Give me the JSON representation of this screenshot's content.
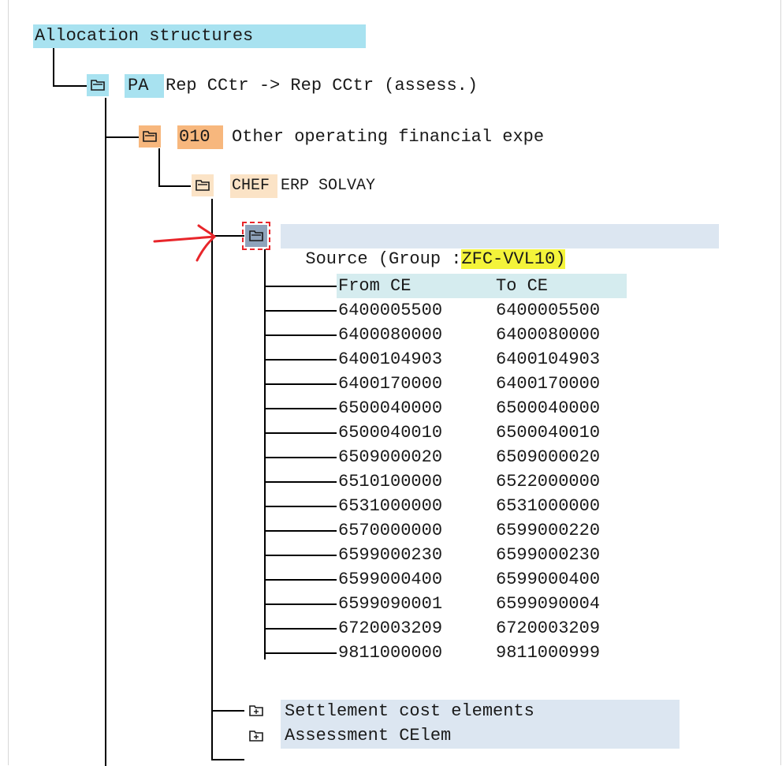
{
  "tree": {
    "root_label": "Allocation structures",
    "level1": {
      "code": "PA",
      "text": "Rep CCtr -> Rep CCtr (assess.)"
    },
    "level2": {
      "code": "010",
      "text": "Other operating financial expe"
    },
    "level3": {
      "code": "CHEF",
      "text": "ERP SOLVAY"
    },
    "source": {
      "prefix": "Source (Group :",
      "group": "ZFC-VVL10",
      "suffix": ")"
    },
    "ce_table": {
      "headers": [
        "From CE",
        "To CE"
      ],
      "rows": [
        [
          "6400005500",
          "6400005500"
        ],
        [
          "6400080000",
          "6400080000"
        ],
        [
          "6400104903",
          "6400104903"
        ],
        [
          "6400170000",
          "6400170000"
        ],
        [
          "6500040000",
          "6500040000"
        ],
        [
          "6500040010",
          "6500040010"
        ],
        [
          "6509000020",
          "6509000020"
        ],
        [
          "6510100000",
          "6522000000"
        ],
        [
          "6531000000",
          "6531000000"
        ],
        [
          "6570000000",
          "6599000220"
        ],
        [
          "6599000230",
          "6599000230"
        ],
        [
          "6599000400",
          "6599000400"
        ],
        [
          "6599090001",
          "6599090004"
        ],
        [
          "6720003209",
          "6720003209"
        ],
        [
          "9811000000",
          "9811000999"
        ]
      ]
    },
    "settlement": {
      "text": "Settlement cost elements"
    },
    "assessment": {
      "text": "Assessment CElem"
    }
  },
  "icons": {
    "folder_open": "folder-icon",
    "folder_closed": "folder-plus-icon"
  },
  "colors": {
    "root_highlight": "#a8e2f0",
    "level2_highlight": "#f7b77d",
    "level3_highlight": "#fbe3c6",
    "row_highlight": "#dce6f1",
    "group_highlight": "#f4f43a",
    "annotation": "#e8262b"
  }
}
